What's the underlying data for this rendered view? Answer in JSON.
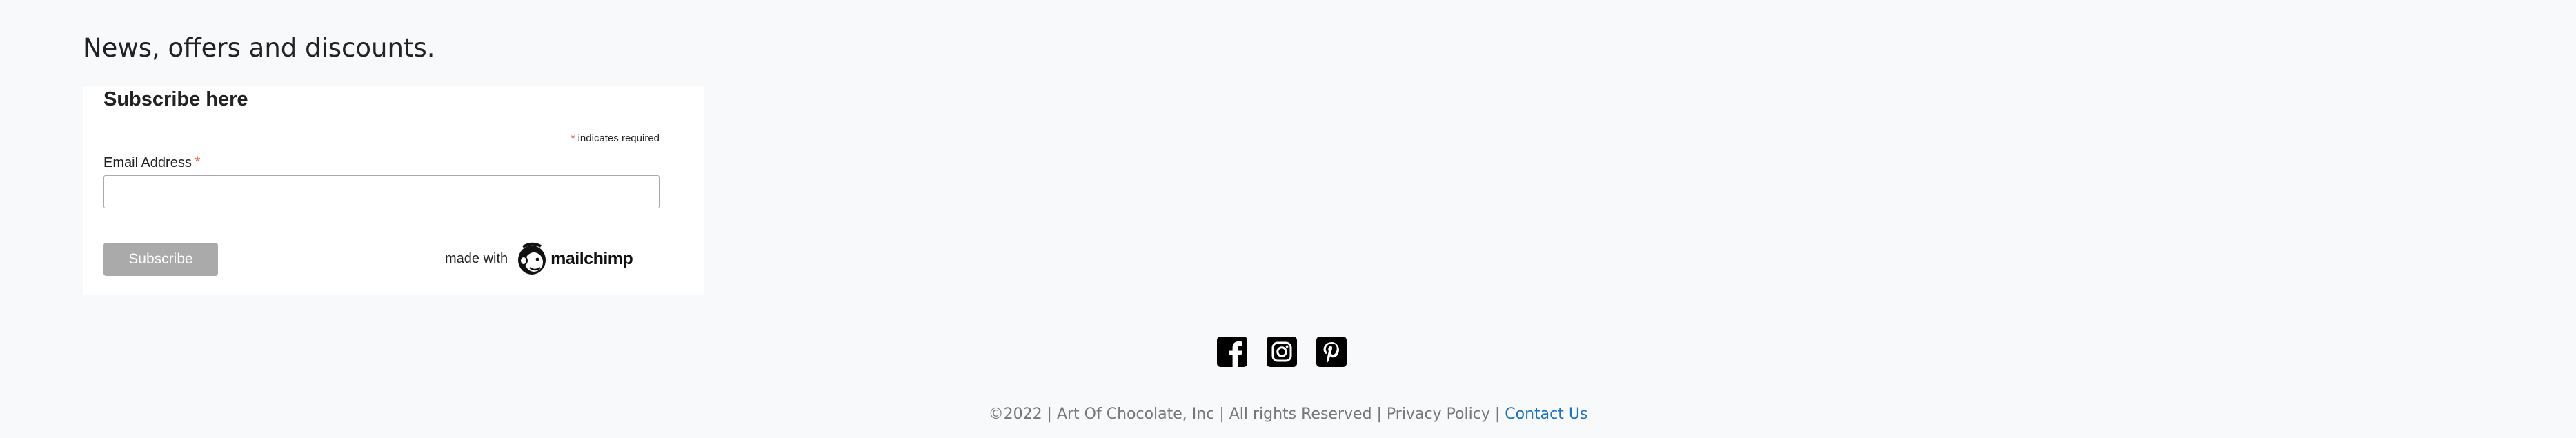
{
  "newsletter": {
    "heading": "News, offers and discounts."
  },
  "signup_form": {
    "title": "Subscribe here",
    "required_asterisk": "*",
    "required_note": "indicates required",
    "email_label": "Email Address",
    "email_asterisk": "*",
    "email_value": "",
    "subscribe_label": "Subscribe",
    "made_with": "made with",
    "brand_wordmark": "mailchimp",
    "colors": {
      "asterisk": "#e85c41",
      "button_bg": "#aaaaaa"
    }
  },
  "social": {
    "icons": [
      "facebook-icon",
      "instagram-icon",
      "pinterest-icon"
    ]
  },
  "footer": {
    "copyright": "©2022 | Art Of Chocolate, Inc | All rights Reserved | Privacy Policy | ",
    "contact_link": "Contact Us",
    "link_color": "#1e73be"
  }
}
